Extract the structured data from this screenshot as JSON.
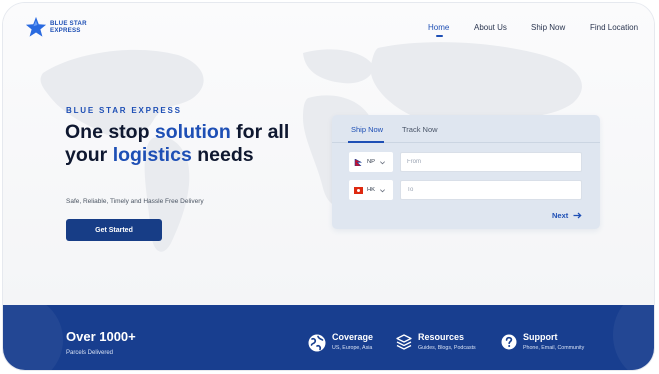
{
  "logo": {
    "line1": "BLUE STAR",
    "line2": "EXPRESS",
    "icon": "star-icon"
  },
  "nav": [
    {
      "label": "Home",
      "active": true
    },
    {
      "label": "About Us",
      "active": false
    },
    {
      "label": "Ship Now",
      "active": false
    },
    {
      "label": "Find Location",
      "active": false
    }
  ],
  "hero": {
    "eyebrow": "BLUE STAR EXPRESS",
    "headline_part1": "One stop ",
    "headline_accent1": "solution",
    "headline_part2": " for all your ",
    "headline_accent2": "logistics",
    "headline_part3": " needs",
    "tagline": "Safe, Reliable, Timely and Hassle Free Delivery",
    "cta_label": "Get Started"
  },
  "ship_card": {
    "tabs": [
      {
        "label": "Ship Now",
        "active": true
      },
      {
        "label": "Track Now",
        "active": false
      }
    ],
    "from": {
      "country_code": "NP",
      "placeholder": "From"
    },
    "to": {
      "country_code": "HK",
      "placeholder": "To"
    },
    "next_label": "Next"
  },
  "banner": {
    "stat_value": "Over 1000+",
    "stat_label": "Parcels Delivered",
    "features": [
      {
        "title": "Coverage",
        "subtitle": "US, Europe, Asia",
        "icon": "globe-icon"
      },
      {
        "title": "Resources",
        "subtitle": "Guides, Blogs, Podcasts",
        "icon": "layers-icon"
      },
      {
        "title": "Support",
        "subtitle": "Phone, Email, Community",
        "icon": "help-icon"
      }
    ]
  },
  "colors": {
    "brand": "#1e4fb5",
    "banner": "#183e8f",
    "cta": "#173d86",
    "card": "#dfe6f0"
  }
}
